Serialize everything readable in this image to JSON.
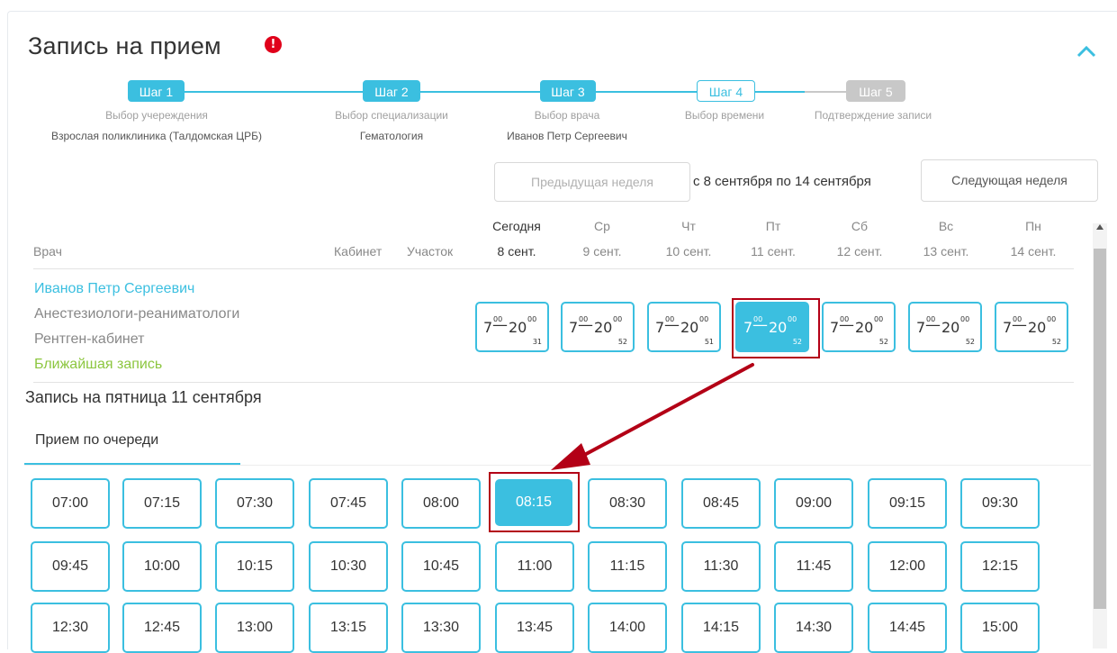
{
  "header": {
    "title": "Запись на прием"
  },
  "steps": [
    {
      "badge": "Шаг 1",
      "caption": "Выбор учереждения",
      "value": "Взрослая поликлиника (Талдомская ЦРБ)",
      "state": "done"
    },
    {
      "badge": "Шаг 2",
      "caption": "Выбор специализации",
      "value": "Гематология",
      "state": "done"
    },
    {
      "badge": "Шаг 3",
      "caption": "Выбор врача",
      "value": "Иванов Петр Сергеевич",
      "state": "done"
    },
    {
      "badge": "Шаг 4",
      "caption": "Выбор времени",
      "value": "",
      "state": "current"
    },
    {
      "badge": "Шаг 5",
      "caption": "Подтверждение записи",
      "value": "",
      "state": "todo"
    }
  ],
  "week": {
    "prev_label": "Предыдущая неделя",
    "range": "с 8 сентября по 14 сентября",
    "next_label": "Следующая неделя"
  },
  "table_headers": {
    "doctor": "Врач",
    "room": "Кабинет",
    "district": "Участок"
  },
  "days": [
    {
      "day": "Сегодня",
      "date": "8 сент."
    },
    {
      "day": "Ср",
      "date": "9 сент."
    },
    {
      "day": "Чт",
      "date": "10 сент."
    },
    {
      "day": "Пт",
      "date": "11 сент."
    },
    {
      "day": "Сб",
      "date": "12 сент."
    },
    {
      "day": "Вс",
      "date": "13 сент."
    },
    {
      "day": "Пн",
      "date": "14 сент."
    }
  ],
  "doctor": {
    "name": "Иванов Петр Сергеевич",
    "specialization": "Анестезиологи-реаниматологи",
    "room": "Рентген-кабинет",
    "nearest": "Ближайшая запись"
  },
  "slots": [
    {
      "from_h": "7",
      "from_m": "00",
      "to_h": "20",
      "to_m": "00",
      "count": "31",
      "selected": false
    },
    {
      "from_h": "7",
      "from_m": "00",
      "to_h": "20",
      "to_m": "00",
      "count": "52",
      "selected": false
    },
    {
      "from_h": "7",
      "from_m": "00",
      "to_h": "20",
      "to_m": "00",
      "count": "51",
      "selected": false
    },
    {
      "from_h": "7",
      "from_m": "00",
      "to_h": "20",
      "to_m": "00",
      "count": "52",
      "selected": true
    },
    {
      "from_h": "7",
      "from_m": "00",
      "to_h": "20",
      "to_m": "00",
      "count": "52",
      "selected": false
    },
    {
      "from_h": "7",
      "from_m": "00",
      "to_h": "20",
      "to_m": "00",
      "count": "52",
      "selected": false
    },
    {
      "from_h": "7",
      "from_m": "00",
      "to_h": "20",
      "to_m": "00",
      "count": "52",
      "selected": false
    }
  ],
  "day_title": "Запись на пятница 11 сентября",
  "queue_tab": "Прием по очереди",
  "times": [
    "07:00",
    "07:15",
    "07:30",
    "07:45",
    "08:00",
    "08:15",
    "08:30",
    "08:45",
    "09:00",
    "09:15",
    "09:30",
    "09:45",
    "10:00",
    "10:15",
    "10:30",
    "10:45",
    "11:00",
    "11:15",
    "11:30",
    "11:45",
    "12:00",
    "12:15",
    "12:30",
    "12:45",
    "13:00",
    "13:15",
    "13:30",
    "13:45",
    "14:00",
    "14:15",
    "14:30",
    "14:45",
    "15:00"
  ],
  "selected_time": "08:15",
  "colors": {
    "accent": "#3bbfe0",
    "highlight": "#b30016",
    "nearest": "#8cc63f",
    "info": "#e0001a",
    "step_todo": "#c8c8c8"
  }
}
